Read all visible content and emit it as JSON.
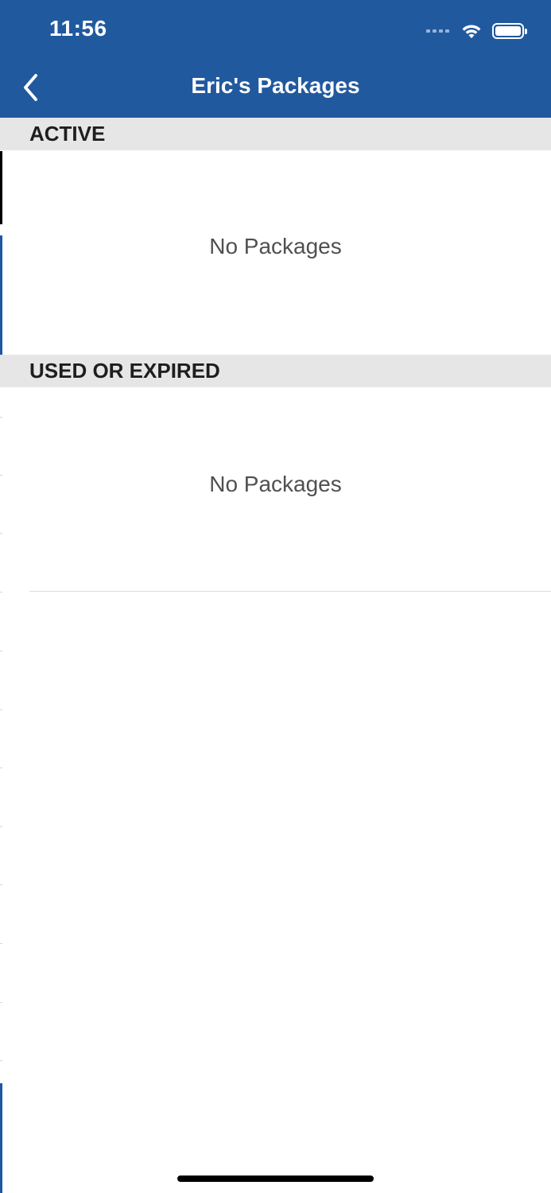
{
  "status_bar": {
    "time": "11:56"
  },
  "nav": {
    "title": "Eric's Packages",
    "back_icon": "chevron-left-icon"
  },
  "sections": [
    {
      "header": "ACTIVE",
      "empty_text": "No Packages"
    },
    {
      "header": "USED OR EXPIRED",
      "empty_text": "No Packages"
    }
  ],
  "colors": {
    "nav_background": "#21599f",
    "section_header_background": "#e6e6e6",
    "text_primary": "#1e1e1e",
    "text_muted": "#505050"
  }
}
